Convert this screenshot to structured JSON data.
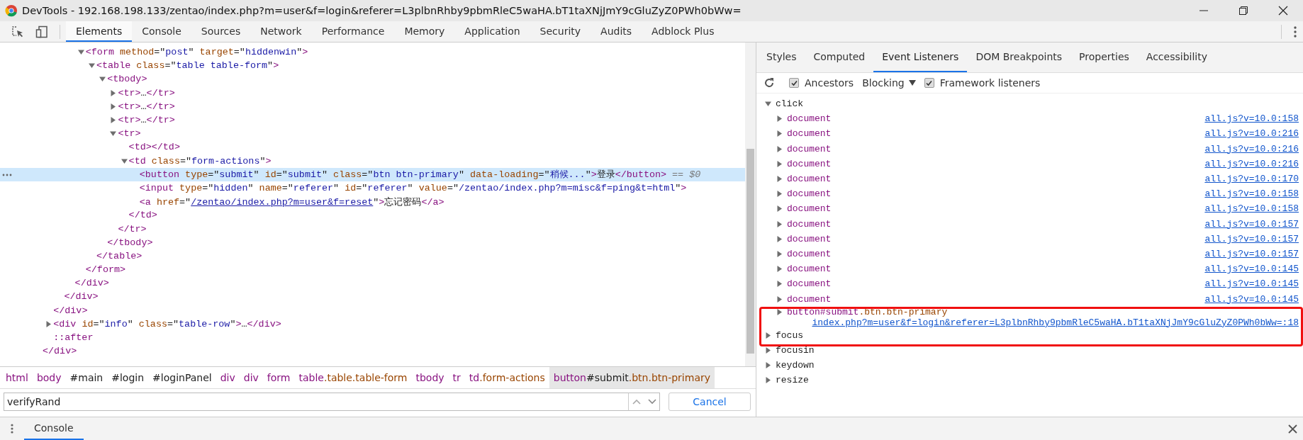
{
  "window": {
    "title": "DevTools - 192.168.198.133/zentao/index.php?m=user&f=login&referer=L3plbnRhby9pbmRleC5waHA.bT1taXNjJmY9cGluZyZ0PWh0bWw="
  },
  "main_tabs": [
    {
      "label": "Elements",
      "selected": true
    },
    {
      "label": "Console",
      "selected": false
    },
    {
      "label": "Sources",
      "selected": false
    },
    {
      "label": "Network",
      "selected": false
    },
    {
      "label": "Performance",
      "selected": false
    },
    {
      "label": "Memory",
      "selected": false
    },
    {
      "label": "Application",
      "selected": false
    },
    {
      "label": "Security",
      "selected": false
    },
    {
      "label": "Audits",
      "selected": false
    },
    {
      "label": "Adblock Plus",
      "selected": false
    }
  ],
  "dom_tree": [
    {
      "close": "</div>",
      "children": [
        {
          "close": "</div>",
          "children": [
            {
              "close": "</div>",
              "children": [
                {
                  "close": "</div>",
                  "children": [
                    {
                      "open": "<form method=\"post\" target=\"hiddenwin\">",
                      "close": "</form>",
                      "expanded": true,
                      "children": [
                        {
                          "open": "<table class=\"table table-form\">",
                          "close": "</table>",
                          "expanded": true,
                          "children": [
                            {
                              "open": "<tbody>",
                              "close": "</tbody>",
                              "expanded": true,
                              "children": [
                                {
                                  "open": "<tr>…</tr>",
                                  "expanded": false
                                },
                                {
                                  "open": "<tr>…</tr>",
                                  "expanded": false
                                },
                                {
                                  "open": "<tr>…</tr>",
                                  "expanded": false
                                },
                                {
                                  "open": "<tr>",
                                  "close": "</tr>",
                                  "expanded": true,
                                  "children": [
                                    {
                                      "open": "<td></td>"
                                    },
                                    {
                                      "open": "<td class=\"form-actions\">",
                                      "close": "</td>",
                                      "expanded": true,
                                      "children": [
                                        {
                                          "open": "<button type=\"submit\" id=\"submit\" class=\"btn btn-primary\" data-loading=\"稍候...\">登录</button>",
                                          "suffix": "== $0",
                                          "selected": true
                                        },
                                        {
                                          "open": "<input type=\"hidden\" name=\"referer\" id=\"referer\" value=\"/zentao/index.php?m=misc&f=ping&t=html\">",
                                          "selected": false
                                        },
                                        {
                                          "open": "<a href=\"/zentao/index.php?m=user&f=reset\">忘记密码</a>",
                                          "link_values": true,
                                          "selected": false
                                        }
                                      ]
                                    }
                                  ]
                                }
                              ]
                            }
                          ]
                        }
                      ]
                    }
                  ]
                }
              ]
            }
          ]
        },
        {
          "open": "<div id=\"info\" class=\"table-row\">…</div>",
          "expanded": false
        },
        {
          "open": "::after"
        }
      ]
    }
  ],
  "breadcrumbs": [
    {
      "text": "html",
      "selected": false
    },
    {
      "text": "body",
      "selected": false
    },
    {
      "text": "#main",
      "selected": false
    },
    {
      "text": "#login",
      "selected": false
    },
    {
      "text": "#loginPanel",
      "selected": false
    },
    {
      "text": "div",
      "selected": false
    },
    {
      "text": "div",
      "selected": false
    },
    {
      "text": "form",
      "selected": false
    },
    {
      "text": "table.table.table-form",
      "selected": false
    },
    {
      "text": "tbody",
      "selected": false
    },
    {
      "text": "tr",
      "selected": false
    },
    {
      "text": "td.form-actions",
      "selected": false
    },
    {
      "text": "button#submit.btn.btn-primary",
      "selected": true
    }
  ],
  "search": {
    "value": "verifyRand",
    "cancel": "Cancel"
  },
  "side_tabs": [
    {
      "label": "Styles",
      "selected": false
    },
    {
      "label": "Computed",
      "selected": false
    },
    {
      "label": "Event Listeners",
      "selected": true
    },
    {
      "label": "DOM Breakpoints",
      "selected": false
    },
    {
      "label": "Properties",
      "selected": false
    },
    {
      "label": "Accessibility",
      "selected": false
    }
  ],
  "toolbar": {
    "ancestors": {
      "label": "Ancestors",
      "checked": true
    },
    "blocking": "Blocking",
    "framework": {
      "label": "Framework listeners",
      "checked": true
    }
  },
  "events": [
    {
      "name": "click",
      "expanded": true,
      "listeners": [
        {
          "node": "document",
          "source": "all.js?v=10.0:158"
        },
        {
          "node": "document",
          "source": "all.js?v=10.0:216"
        },
        {
          "node": "document",
          "source": "all.js?v=10.0:216"
        },
        {
          "node": "document",
          "source": "all.js?v=10.0:216"
        },
        {
          "node": "document",
          "source": "all.js?v=10.0:170"
        },
        {
          "node": "document",
          "source": "all.js?v=10.0:158"
        },
        {
          "node": "document",
          "source": "all.js?v=10.0:158"
        },
        {
          "node": "document",
          "source": "all.js?v=10.0:157"
        },
        {
          "node": "document",
          "source": "all.js?v=10.0:157"
        },
        {
          "node": "document",
          "source": "all.js?v=10.0:157"
        },
        {
          "node": "document",
          "source": "all.js?v=10.0:145"
        },
        {
          "node": "document",
          "source": "all.js?v=10.0:145"
        },
        {
          "node": "document",
          "source": "all.js?v=10.0:145"
        },
        {
          "node": "button#submit.btn.btn-primary",
          "source": "index.php?m=user&f=login&referer=L3plbnRhby9pbmRleC5waHA.bT1taXNjJmY9cGluZyZ0PWh0bWw=:18"
        }
      ]
    },
    {
      "name": "focus",
      "expanded": false
    },
    {
      "name": "focusin",
      "expanded": false
    },
    {
      "name": "keydown",
      "expanded": false
    },
    {
      "name": "resize",
      "expanded": false
    }
  ],
  "drawer": {
    "tab": {
      "label": "Console",
      "selected": true
    }
  }
}
